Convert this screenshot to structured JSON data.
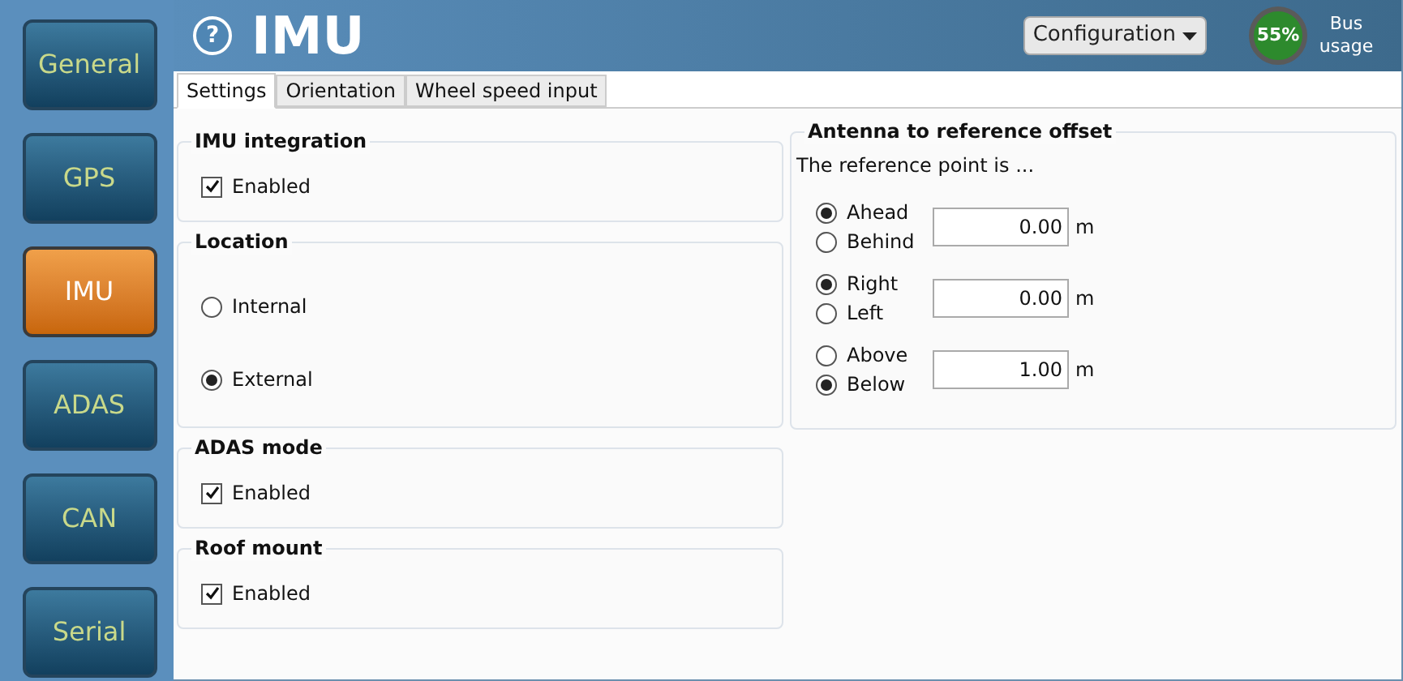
{
  "sidebar": {
    "items": [
      {
        "label": "General",
        "selected": false
      },
      {
        "label": "GPS",
        "selected": false
      },
      {
        "label": "IMU",
        "selected": true
      },
      {
        "label": "ADAS",
        "selected": false
      },
      {
        "label": "CAN",
        "selected": false
      },
      {
        "label": "Serial",
        "selected": false
      }
    ]
  },
  "header": {
    "help": "?",
    "title": "IMU",
    "menu": "Configuration",
    "bus_value": "55%",
    "bus_label": "Bus usage"
  },
  "tabs": [
    {
      "label": "Settings",
      "selected": true
    },
    {
      "label": "Orientation",
      "selected": false
    },
    {
      "label": "Wheel speed input",
      "selected": false
    }
  ],
  "groups": [
    {
      "kind": "checkbox",
      "title": "IMU integration",
      "label": "Enabled",
      "checked": true
    },
    {
      "kind": "radio",
      "title": "Location",
      "options": [
        {
          "label": "Internal",
          "selected": false
        },
        {
          "label": "External",
          "selected": true
        }
      ]
    },
    {
      "kind": "checkbox",
      "title": "ADAS mode",
      "label": "Enabled",
      "checked": true
    },
    {
      "kind": "checkbox",
      "title": "Roof mount",
      "label": "Enabled",
      "checked": true
    }
  ],
  "offset": {
    "title": "Antenna to reference offset",
    "intro": "The reference point is ...",
    "rows": [
      {
        "options": [
          {
            "label": "Ahead",
            "selected": true
          },
          {
            "label": "Behind",
            "selected": false
          }
        ],
        "value": "0.00",
        "unit": "m"
      },
      {
        "options": [
          {
            "label": "Right",
            "selected": true
          },
          {
            "label": "Left",
            "selected": false
          }
        ],
        "value": "0.00",
        "unit": "m"
      },
      {
        "options": [
          {
            "label": "Above",
            "selected": false
          },
          {
            "label": "Below",
            "selected": true
          }
        ],
        "value": "1.00",
        "unit": "m"
      }
    ]
  }
}
